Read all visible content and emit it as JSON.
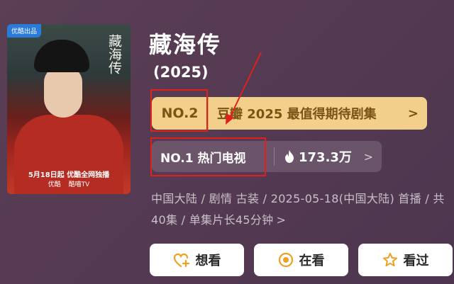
{
  "poster": {
    "badge": "优酷出品",
    "title": "藏海传",
    "release": "5月18日起 优酷全网独播",
    "platforms": [
      "优酷",
      "酷喵TV"
    ]
  },
  "show": {
    "title": "藏海传",
    "year": "(2025)"
  },
  "douban": {
    "rank": "NO.2",
    "text": "豆瓣 2025 最值得期待剧集",
    "chevron": ">"
  },
  "hot": {
    "rank": "NO.1 热门电视",
    "heat": "173.3万",
    "chevron": ">"
  },
  "meta": {
    "line": "中国大陆 / 剧情 古装 / 2025-05-18(中国大陆) 首播 / 共40集 / 单集片长45分钟",
    "chevron": ">"
  },
  "actions": {
    "want": "想看",
    "watching": "在看",
    "watched": "看过"
  },
  "colors": {
    "accent_gold": "#f2cf8a",
    "annotation_red": "#e0201c",
    "icon_orange": "#f0a020"
  },
  "icons": [
    "flame-icon",
    "heart-plus-icon",
    "target-icon",
    "star-icon",
    "chevron-right-icon"
  ]
}
